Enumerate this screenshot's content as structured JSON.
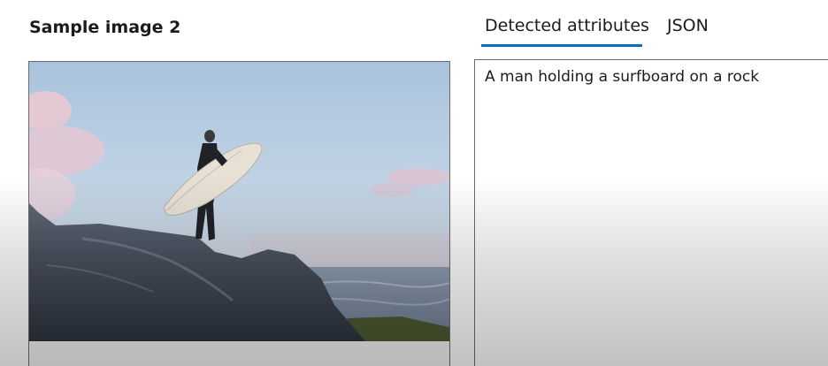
{
  "sample": {
    "title": "Sample image 2",
    "image_alt": "surfer-on-rock-photo"
  },
  "tabs": [
    {
      "label": "Detected attributes",
      "active": true
    },
    {
      "label": "JSON",
      "active": false
    }
  ],
  "result": {
    "caption": "A man holding a surfboard on a rock"
  },
  "colors": {
    "accent": "#0f6cbd",
    "text": "#1b1b1b",
    "border": "#6b6b6b"
  }
}
